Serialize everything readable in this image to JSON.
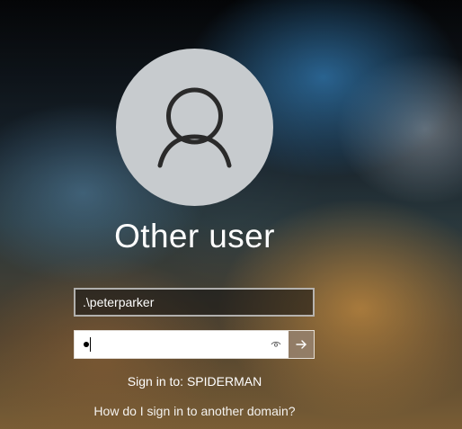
{
  "user_tile": {
    "avatar_icon": "user-silhouette-icon",
    "display_name": "Other user"
  },
  "username_field": {
    "value": ".\\peterparker"
  },
  "password_field": {
    "masked_char_count": 1,
    "reveal_icon": "eye-icon",
    "submit_icon": "arrow-right-icon"
  },
  "sign_in_to": "Sign in to: SPIDERMAN",
  "domain_help_link": "How do I sign in to another domain?",
  "colors": {
    "avatar_bg": "#c7cbce",
    "avatar_stroke": "#2a2a2a",
    "submit_bg": "#968270"
  }
}
